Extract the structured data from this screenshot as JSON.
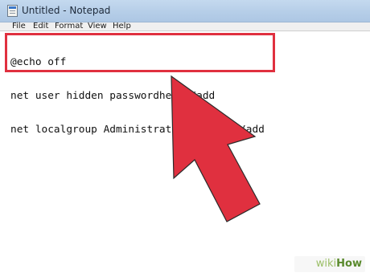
{
  "window": {
    "title": "Untitled - Notepad"
  },
  "menu": {
    "file": "File",
    "edit": "Edit",
    "format": "Format",
    "view": "View",
    "help": "Help"
  },
  "editor": {
    "lines": [
      "@echo off",
      "net user hidden passwordhere /add",
      "net localgroup Administrators hidden /add"
    ]
  },
  "annotation": {
    "highlight_color": "#e0303f",
    "arrow_color": "#e0303f",
    "arrow_icon": "up-left-arrow-icon"
  },
  "watermark": {
    "wiki": "wiki",
    "how": "How"
  }
}
